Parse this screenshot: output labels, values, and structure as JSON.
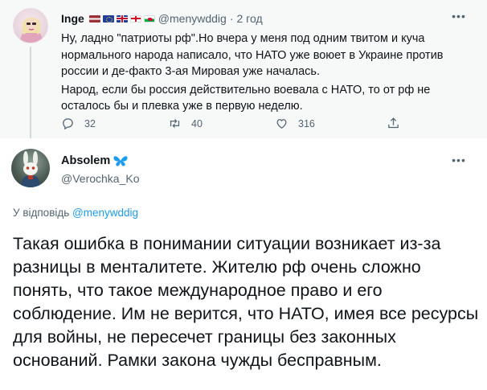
{
  "parent_tweet": {
    "author_name": "Inge",
    "flags": [
      "latvia-flag",
      "eu-flag",
      "uk-flag",
      "england-flag",
      "wales-flag"
    ],
    "handle": "@menywddig",
    "separator": "·",
    "time": "2 год",
    "more_icon": "more-icon",
    "paragraphs": [
      "Ну, ладно \"патриоты рф\".Но вчера у меня под одним твитом и куча нормального народа написало, что НАТО уже воюет в Украине против россии и де-факто 3-ая Мировая уже началась.",
      "Народ, если бы россия действительно воевала с НАТО, то от рф не осталось бы и плевка уже в первую неделю."
    ],
    "actions": {
      "reply_count": "32",
      "retweet_count": "40",
      "like_count": "316"
    }
  },
  "reply_tweet": {
    "author_name": "Absolem",
    "author_emoji": "butterfly-icon",
    "handle": "@Verochka_Ko",
    "replying_label": "У відповідь",
    "replying_to": "@menywddig",
    "text": "Такая ошибка в понимании ситуации возникает из-за разницы в менталитете. Жителю рф очень сложно понять, что такое международное право и его соблюдение. Им не верится, что НАТО, имея все ресурсы для войны, не пересечет границы без законных оснований. Рамки закона чужды бесправным."
  },
  "colors": {
    "text_primary": "#0f1419",
    "text_secondary": "#536471",
    "accent": "#1d9bf0",
    "parent_background": "#f7f9f9",
    "thread_line": "#cfd9de",
    "butterfly": "#1d9bf0"
  }
}
